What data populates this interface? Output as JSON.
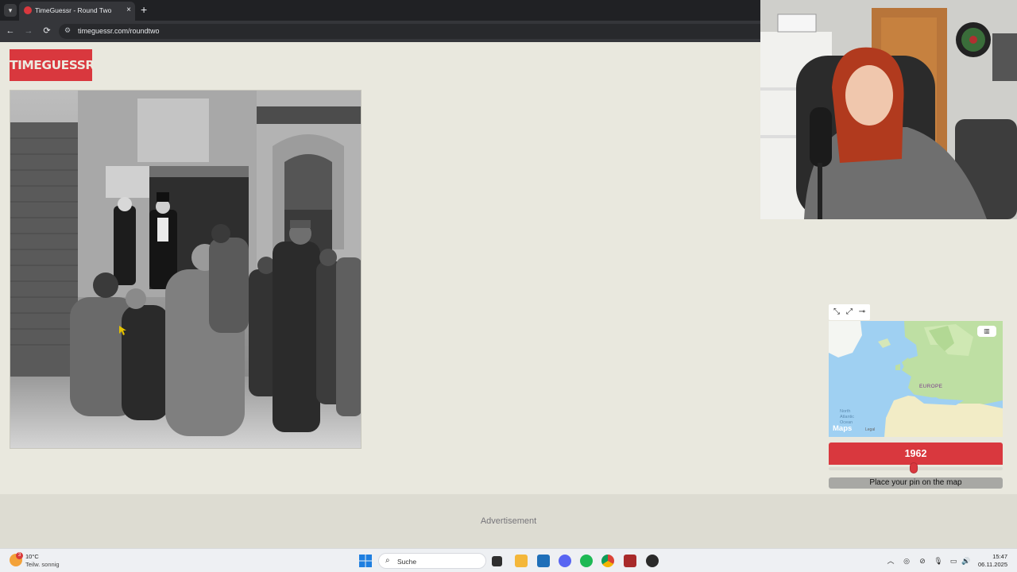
{
  "browser": {
    "tab_title": "TimeGuessr - Round Two",
    "tab_close": "×",
    "new_tab": "+",
    "url": "timeguessr.com/roundtwo",
    "back": "←",
    "forward": "→",
    "reload": "⟳"
  },
  "page": {
    "logo_text": "TIMEGUESSR",
    "photo_icon": "black-and-white-street-crowd-photo"
  },
  "map": {
    "label_europe": "EUROPE",
    "label_atlantic": "North Atlantic Ocean",
    "brand": "Maps",
    "legal": "Legal"
  },
  "guess": {
    "year": "1962",
    "pin_text": "Place your pin on the map",
    "year_slider_fraction": 0.49
  },
  "ad": {
    "label": "Advertisement"
  },
  "taskbar": {
    "temp": "10°C",
    "weather": "Teilw. sonnig",
    "weather_badge": "3",
    "search_placeholder": "Suche",
    "time": "15:47",
    "date": "06.11.2025"
  },
  "colors": {
    "brand_red": "#d9383e",
    "page_bg": "#e9e8de"
  }
}
